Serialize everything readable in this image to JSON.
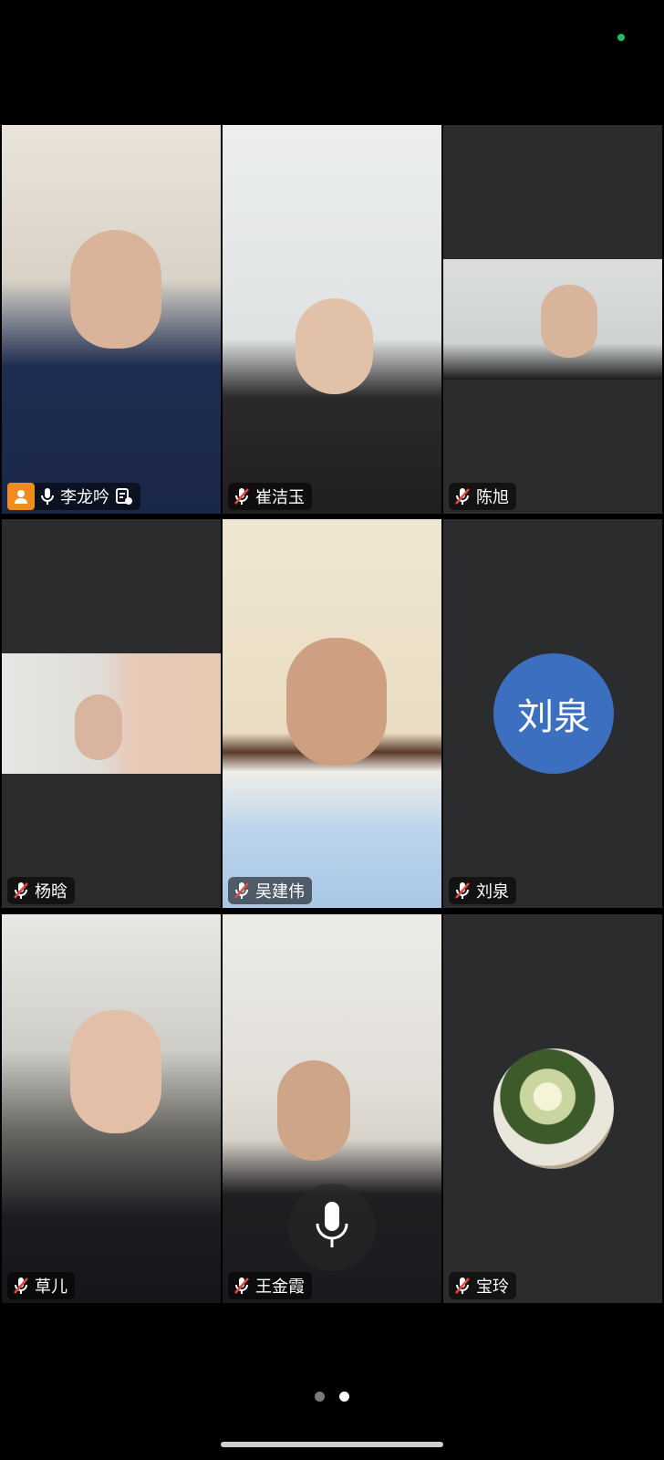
{
  "colors": {
    "accent": "#1fbf5a",
    "avatar_blue": "#3d6fc0",
    "host_orange": "#f08c1e",
    "tile_bg": "#2b2c2e",
    "muted_red": "#e5483d",
    "dot_active": "#ffffff",
    "dot_inactive": "#7a7a7a"
  },
  "participants": [
    {
      "name": "李龙吟",
      "muted": false,
      "host": true,
      "active_speaker": true,
      "video": "on"
    },
    {
      "name": "崔洁玉",
      "muted": true,
      "video": "on"
    },
    {
      "name": "陈旭",
      "muted": true,
      "video": "small"
    },
    {
      "name": "杨晗",
      "muted": true,
      "video": "small"
    },
    {
      "name": "吴建伟",
      "muted": true,
      "video": "on"
    },
    {
      "name": "刘泉",
      "muted": true,
      "video": "off",
      "avatar_text": "刘泉"
    },
    {
      "name": "草儿",
      "muted": true,
      "video": "on"
    },
    {
      "name": "王金霞",
      "muted": true,
      "video": "on"
    },
    {
      "name": "宝玲",
      "muted": true,
      "video": "off",
      "avatar": "photo"
    }
  ],
  "pager": {
    "pages": 2,
    "current": 2
  }
}
